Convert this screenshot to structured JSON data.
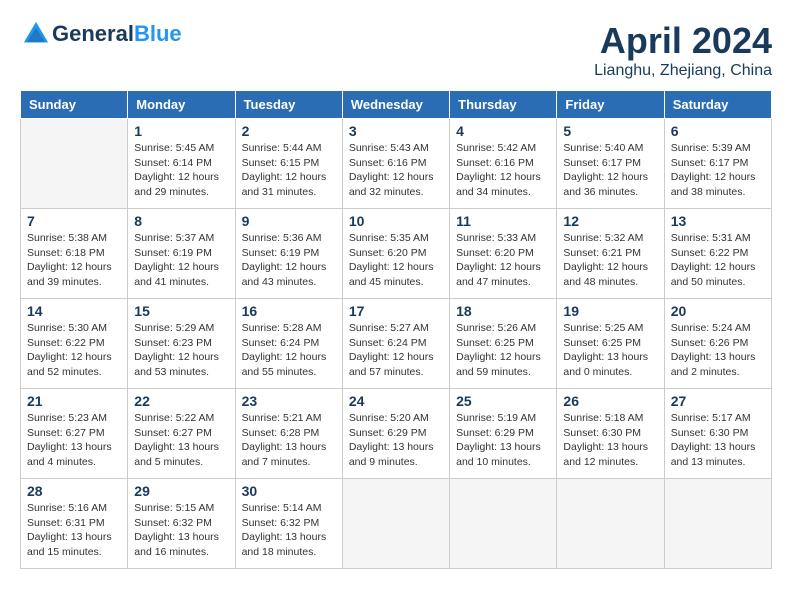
{
  "logo": {
    "line1": "General",
    "line2": "Blue"
  },
  "title": "April 2024",
  "location": "Lianghu, Zhejiang, China",
  "days_of_week": [
    "Sunday",
    "Monday",
    "Tuesday",
    "Wednesday",
    "Thursday",
    "Friday",
    "Saturday"
  ],
  "weeks": [
    [
      {
        "day": "",
        "info": ""
      },
      {
        "day": "1",
        "info": "Sunrise: 5:45 AM\nSunset: 6:14 PM\nDaylight: 12 hours\nand 29 minutes."
      },
      {
        "day": "2",
        "info": "Sunrise: 5:44 AM\nSunset: 6:15 PM\nDaylight: 12 hours\nand 31 minutes."
      },
      {
        "day": "3",
        "info": "Sunrise: 5:43 AM\nSunset: 6:16 PM\nDaylight: 12 hours\nand 32 minutes."
      },
      {
        "day": "4",
        "info": "Sunrise: 5:42 AM\nSunset: 6:16 PM\nDaylight: 12 hours\nand 34 minutes."
      },
      {
        "day": "5",
        "info": "Sunrise: 5:40 AM\nSunset: 6:17 PM\nDaylight: 12 hours\nand 36 minutes."
      },
      {
        "day": "6",
        "info": "Sunrise: 5:39 AM\nSunset: 6:17 PM\nDaylight: 12 hours\nand 38 minutes."
      }
    ],
    [
      {
        "day": "7",
        "info": "Sunrise: 5:38 AM\nSunset: 6:18 PM\nDaylight: 12 hours\nand 39 minutes."
      },
      {
        "day": "8",
        "info": "Sunrise: 5:37 AM\nSunset: 6:19 PM\nDaylight: 12 hours\nand 41 minutes."
      },
      {
        "day": "9",
        "info": "Sunrise: 5:36 AM\nSunset: 6:19 PM\nDaylight: 12 hours\nand 43 minutes."
      },
      {
        "day": "10",
        "info": "Sunrise: 5:35 AM\nSunset: 6:20 PM\nDaylight: 12 hours\nand 45 minutes."
      },
      {
        "day": "11",
        "info": "Sunrise: 5:33 AM\nSunset: 6:20 PM\nDaylight: 12 hours\nand 47 minutes."
      },
      {
        "day": "12",
        "info": "Sunrise: 5:32 AM\nSunset: 6:21 PM\nDaylight: 12 hours\nand 48 minutes."
      },
      {
        "day": "13",
        "info": "Sunrise: 5:31 AM\nSunset: 6:22 PM\nDaylight: 12 hours\nand 50 minutes."
      }
    ],
    [
      {
        "day": "14",
        "info": "Sunrise: 5:30 AM\nSunset: 6:22 PM\nDaylight: 12 hours\nand 52 minutes."
      },
      {
        "day": "15",
        "info": "Sunrise: 5:29 AM\nSunset: 6:23 PM\nDaylight: 12 hours\nand 53 minutes."
      },
      {
        "day": "16",
        "info": "Sunrise: 5:28 AM\nSunset: 6:24 PM\nDaylight: 12 hours\nand 55 minutes."
      },
      {
        "day": "17",
        "info": "Sunrise: 5:27 AM\nSunset: 6:24 PM\nDaylight: 12 hours\nand 57 minutes."
      },
      {
        "day": "18",
        "info": "Sunrise: 5:26 AM\nSunset: 6:25 PM\nDaylight: 12 hours\nand 59 minutes."
      },
      {
        "day": "19",
        "info": "Sunrise: 5:25 AM\nSunset: 6:25 PM\nDaylight: 13 hours\nand 0 minutes."
      },
      {
        "day": "20",
        "info": "Sunrise: 5:24 AM\nSunset: 6:26 PM\nDaylight: 13 hours\nand 2 minutes."
      }
    ],
    [
      {
        "day": "21",
        "info": "Sunrise: 5:23 AM\nSunset: 6:27 PM\nDaylight: 13 hours\nand 4 minutes."
      },
      {
        "day": "22",
        "info": "Sunrise: 5:22 AM\nSunset: 6:27 PM\nDaylight: 13 hours\nand 5 minutes."
      },
      {
        "day": "23",
        "info": "Sunrise: 5:21 AM\nSunset: 6:28 PM\nDaylight: 13 hours\nand 7 minutes."
      },
      {
        "day": "24",
        "info": "Sunrise: 5:20 AM\nSunset: 6:29 PM\nDaylight: 13 hours\nand 9 minutes."
      },
      {
        "day": "25",
        "info": "Sunrise: 5:19 AM\nSunset: 6:29 PM\nDaylight: 13 hours\nand 10 minutes."
      },
      {
        "day": "26",
        "info": "Sunrise: 5:18 AM\nSunset: 6:30 PM\nDaylight: 13 hours\nand 12 minutes."
      },
      {
        "day": "27",
        "info": "Sunrise: 5:17 AM\nSunset: 6:30 PM\nDaylight: 13 hours\nand 13 minutes."
      }
    ],
    [
      {
        "day": "28",
        "info": "Sunrise: 5:16 AM\nSunset: 6:31 PM\nDaylight: 13 hours\nand 15 minutes."
      },
      {
        "day": "29",
        "info": "Sunrise: 5:15 AM\nSunset: 6:32 PM\nDaylight: 13 hours\nand 16 minutes."
      },
      {
        "day": "30",
        "info": "Sunrise: 5:14 AM\nSunset: 6:32 PM\nDaylight: 13 hours\nand 18 minutes."
      },
      {
        "day": "",
        "info": ""
      },
      {
        "day": "",
        "info": ""
      },
      {
        "day": "",
        "info": ""
      },
      {
        "day": "",
        "info": ""
      }
    ]
  ]
}
